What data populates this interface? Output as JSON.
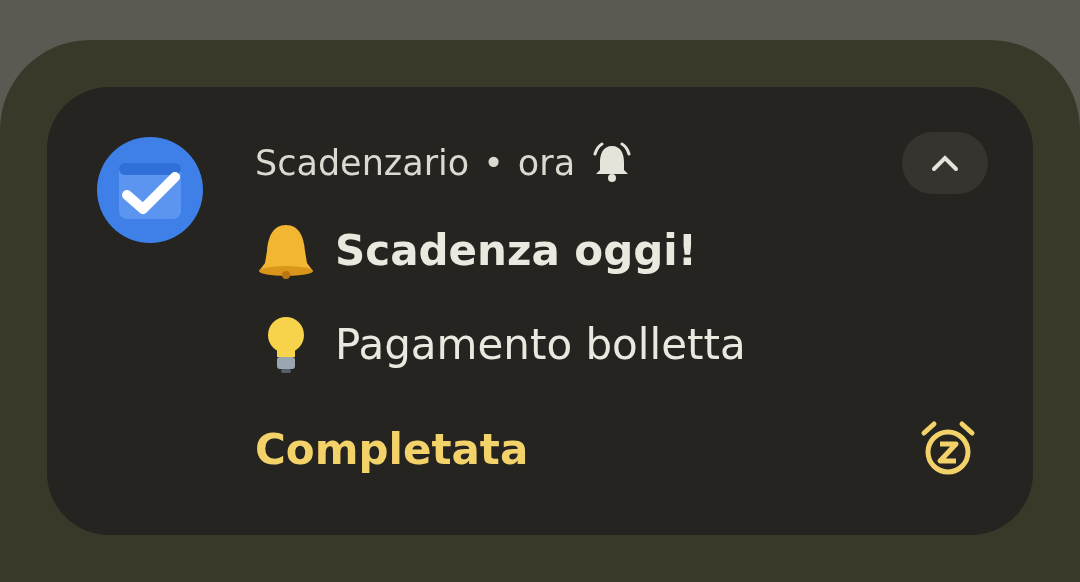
{
  "notification": {
    "app_name": "Scadenzario",
    "separator": "•",
    "time": "ora",
    "alert_on": true,
    "expanded": true,
    "title": "Scadenza oggi!",
    "body": "Pagamento bolletta",
    "actions": [
      {
        "label": "Completata"
      }
    ]
  }
}
